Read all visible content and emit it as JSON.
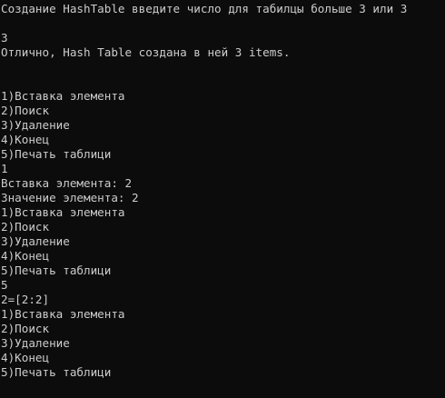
{
  "console": {
    "lines": [
      "Создание HashTable введите число для табилцы больше 3 или 3",
      "",
      "3",
      "Отлично, Hash Table создана в ней 3 items.",
      "",
      "",
      "1)Вставка элемента",
      "2)Поиск",
      "3)Удаление",
      "4)Конец",
      "5)Печать таблици",
      "1",
      "Вставка элемента: 2",
      "Значение элемента: 2",
      "1)Вставка элемента",
      "2)Поиск",
      "3)Удаление",
      "4)Конец",
      "5)Печать таблици",
      "5",
      "2=[2:2]",
      "1)Вставка элемента",
      "2)Поиск",
      "3)Удаление",
      "4)Конец",
      "5)Печать таблици"
    ]
  },
  "colors": {
    "background": "#0c0c0c",
    "text": "#cccccc"
  }
}
